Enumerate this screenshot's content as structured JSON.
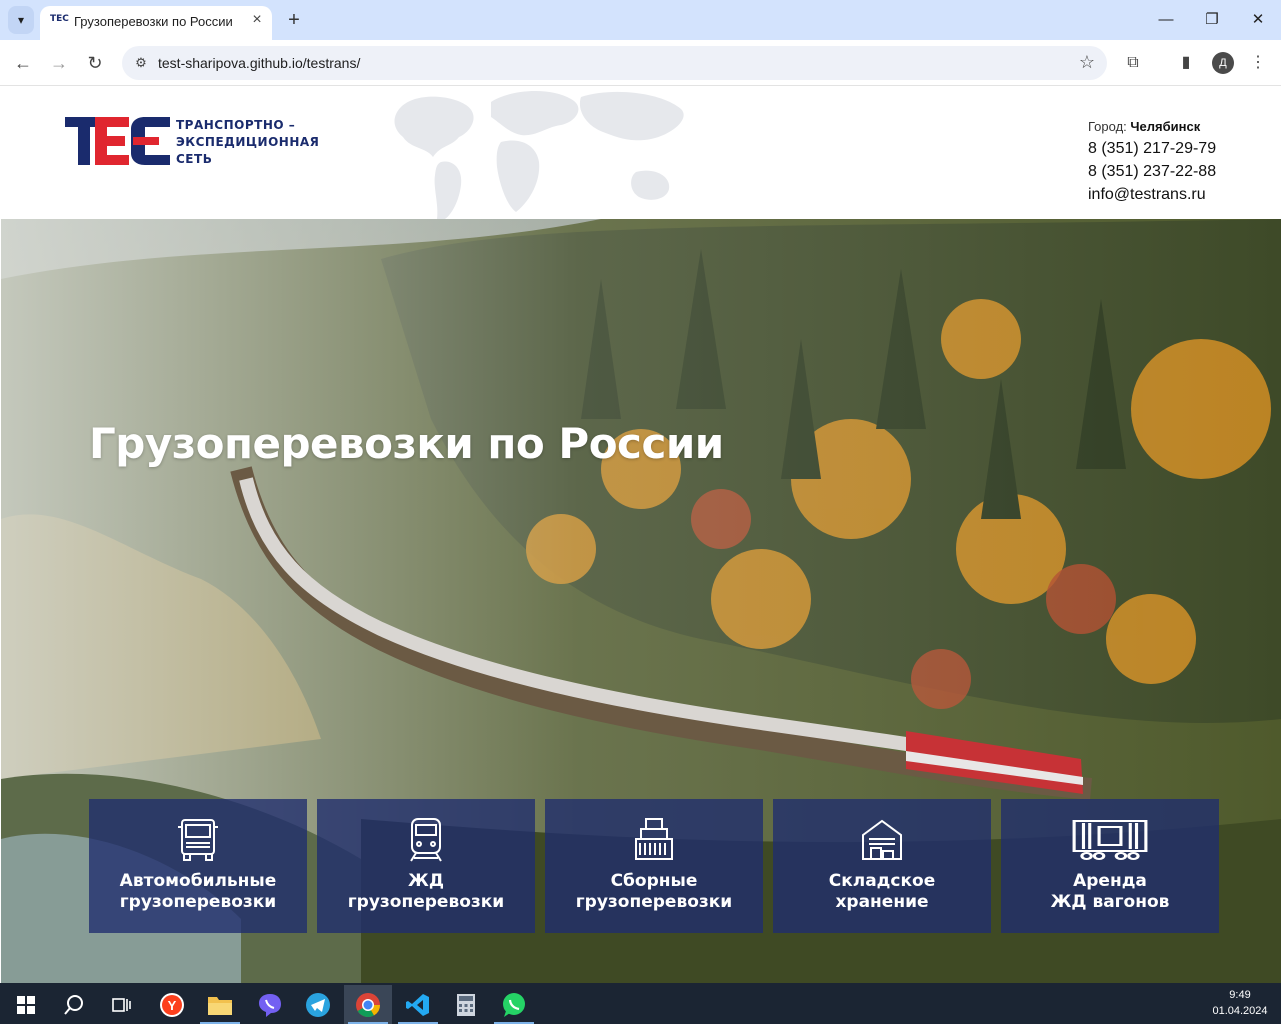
{
  "browser": {
    "tab_title": "Грузоперевозки по России",
    "favicon_text": "TEC",
    "url": "test-sharipova.github.io/testrans/",
    "profile_initial": "Д"
  },
  "site": {
    "logo_mark": "TEC",
    "logo_lines": [
      "ТРАНСПОРТНО –",
      "ЭКСПЕДИЦИОННАЯ",
      "СЕТЬ"
    ],
    "city_label": "Город:",
    "city": "Челябинск",
    "phone1": "8 (351) 217-29-79",
    "phone2": "8 (351) 237-22-88",
    "email": "info@testrans.ru",
    "brand_color": "#1a2b6d",
    "accent_color": "#e0262f"
  },
  "hero": {
    "title": "Грузоперевозки по России"
  },
  "services": [
    {
      "icon": "truck-icon",
      "label": "Автомобильные\nгрузоперевозки"
    },
    {
      "icon": "train-icon",
      "label": "ЖД\nгрузоперевозки"
    },
    {
      "icon": "cargo-stack-icon",
      "label": "Сборные\nгрузоперевозки"
    },
    {
      "icon": "warehouse-icon",
      "label": "Складское\nхранение"
    },
    {
      "icon": "railcar-icon",
      "label": "Аренда\nЖД вагонов"
    }
  ],
  "taskbar": {
    "time": "9:49",
    "date": "01.04.2024",
    "apps": [
      "start-icon",
      "search-icon",
      "task-view-icon",
      "yandex-browser-icon",
      "file-explorer-icon",
      "viber-icon",
      "telegram-icon",
      "chrome-icon",
      "vscode-icon",
      "calculator-icon",
      "whatsapp-icon"
    ]
  }
}
